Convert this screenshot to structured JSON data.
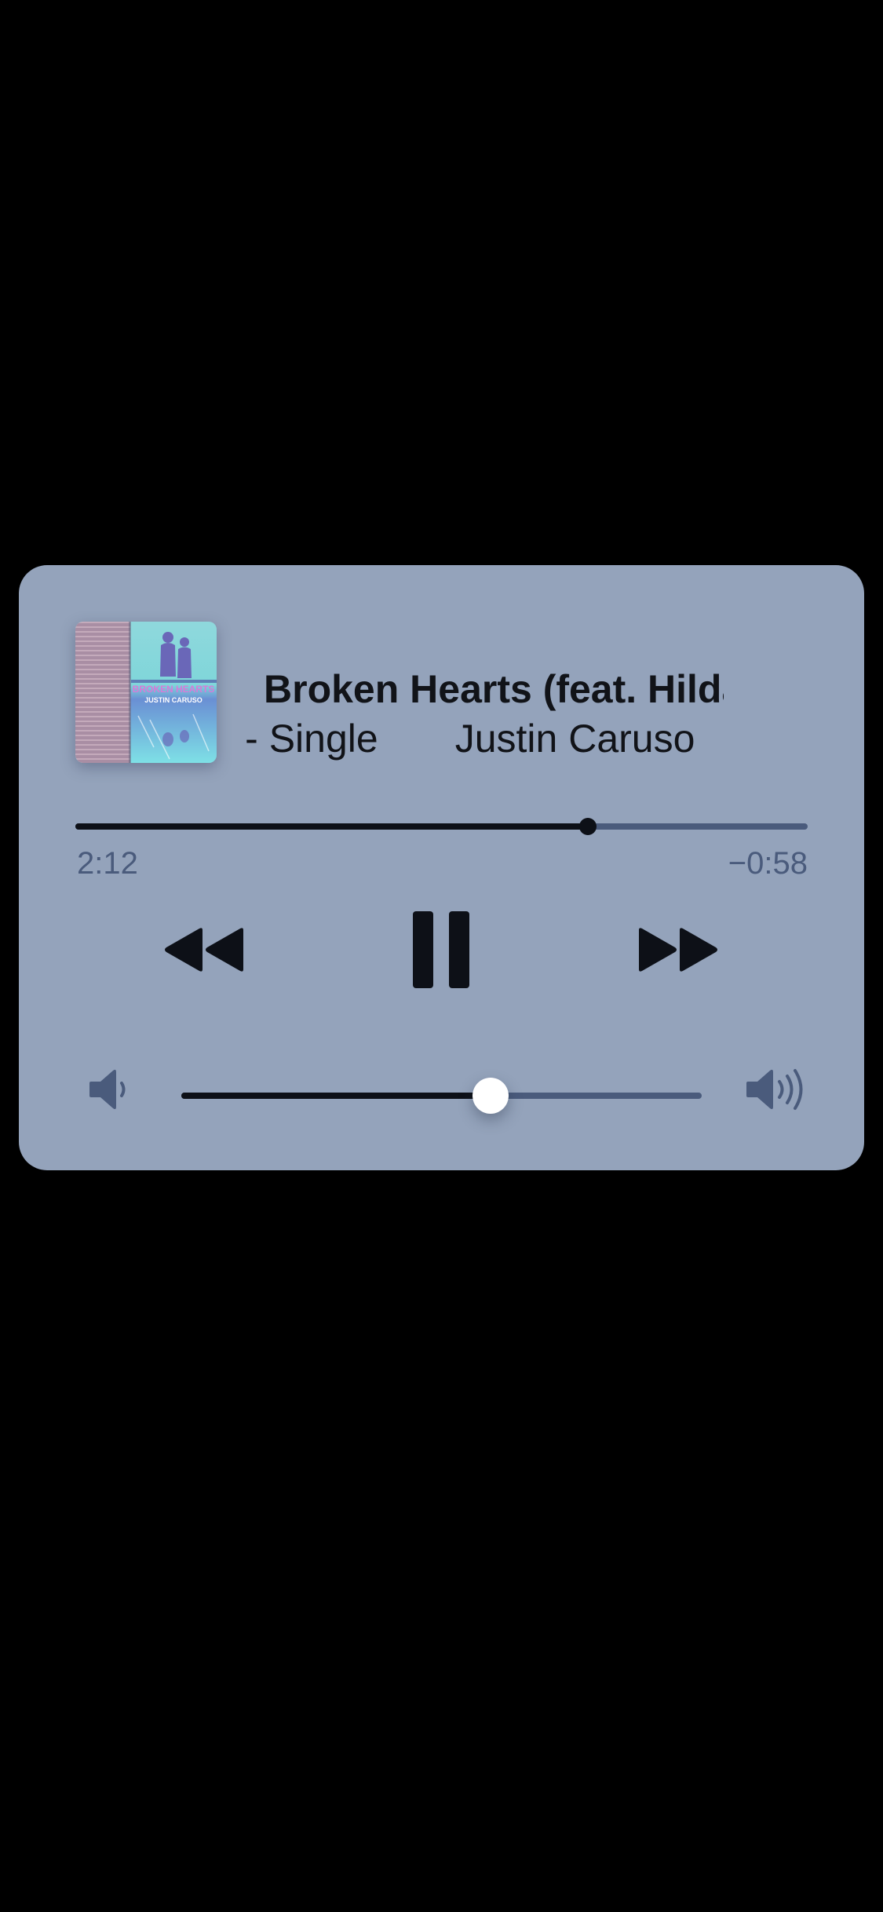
{
  "now_playing": {
    "title": "Broken Hearts (feat. Hilda)",
    "album": "Broken Hearts (feat. Hilda) - Single",
    "album_visible": "da) - Single",
    "artist": "Justin Caruso",
    "artwork_text": {
      "title": "BROKEN HEARTS",
      "artist": "JUSTIN CARUSO"
    }
  },
  "progress": {
    "elapsed": "2:12",
    "remaining": "−0:58",
    "fraction": 0.7
  },
  "controls": {
    "rewind_icon": "rewind-icon",
    "pause_icon": "pause-icon",
    "forward_icon": "fast-forward-icon"
  },
  "volume": {
    "level": 0.595,
    "min_icon": "speaker-low-icon",
    "max_icon": "speaker-high-icon"
  },
  "colors": {
    "card_background": "#94a3bb",
    "accent_dark": "#0d1017",
    "track_muted": "#4a5b7c",
    "knob": "#ffffff"
  }
}
